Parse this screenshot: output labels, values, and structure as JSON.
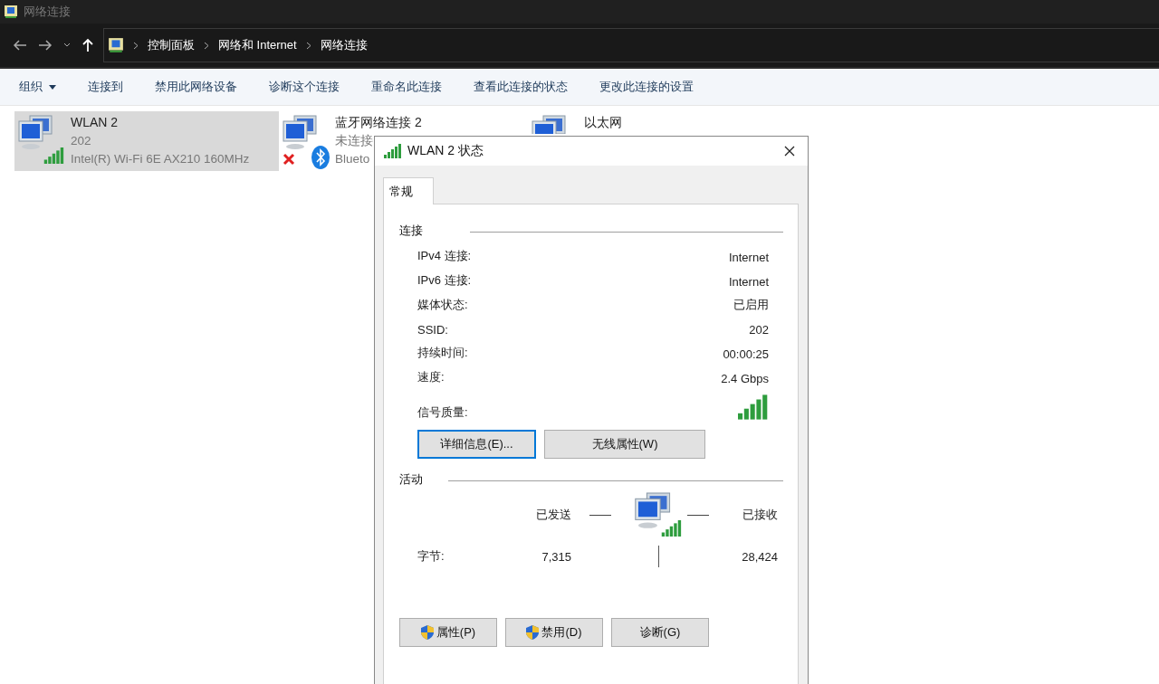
{
  "window": {
    "title": "网络连接"
  },
  "breadcrumbs": [
    "控制面板",
    "网络和 Internet",
    "网络连接"
  ],
  "commands": [
    {
      "label": "组织",
      "dropdown": true
    },
    {
      "label": "连接到",
      "dropdown": false
    },
    {
      "label": "禁用此网络设备",
      "dropdown": false
    },
    {
      "label": "诊断这个连接",
      "dropdown": false
    },
    {
      "label": "重命名此连接",
      "dropdown": false
    },
    {
      "label": "查看此连接的状态",
      "dropdown": false
    },
    {
      "label": "更改此连接的设置",
      "dropdown": false
    }
  ],
  "connections": [
    {
      "kind": "wifi",
      "name": "WLAN 2",
      "lines": [
        "202",
        "Intel(R) Wi-Fi 6E AX210 160MHz"
      ],
      "selected": true
    },
    {
      "kind": "bluetooth",
      "name": "蓝牙网络连接 2",
      "lines": [
        "未连接",
        "Blueto"
      ],
      "selected": false
    },
    {
      "kind": "ethernet",
      "name": "以太网",
      "selected": false
    }
  ],
  "dialog": {
    "title": "WLAN 2 状态",
    "tabs": [
      {
        "label": "常规",
        "selected": true
      }
    ],
    "connection": {
      "heading": "连接",
      "rows": [
        {
          "kind": "text",
          "label": "IPv4 连接:",
          "value": "Internet"
        },
        {
          "kind": "text",
          "label": "IPv6 连接:",
          "value": "Internet"
        },
        {
          "kind": "text",
          "label": "媒体状态:",
          "value": "已启用"
        },
        {
          "kind": "text",
          "label": "SSID:",
          "value": "202"
        },
        {
          "kind": "text",
          "label": "持续时间:",
          "value": "00:00:25"
        },
        {
          "kind": "text",
          "label": "速度:",
          "value": "2.4 Gbps"
        },
        {
          "kind": "signal",
          "label": "信号质量:"
        }
      ]
    },
    "buttons": [
      {
        "label": "详细信息(E)...",
        "default": true
      },
      {
        "label": "无线属性(W)",
        "default": false
      }
    ],
    "activity": {
      "heading": "活动",
      "sent_label": "已发送",
      "received_label": "已接收",
      "bytes_label": "字节:",
      "bytes_sent": "7,315",
      "bytes_received": "28,424"
    },
    "footer_buttons": [
      {
        "label": "属性(P)",
        "kind": "shield"
      },
      {
        "label": "禁用(D)",
        "kind": "shield"
      },
      {
        "label": "诊断(G)",
        "kind": "plain"
      }
    ]
  }
}
